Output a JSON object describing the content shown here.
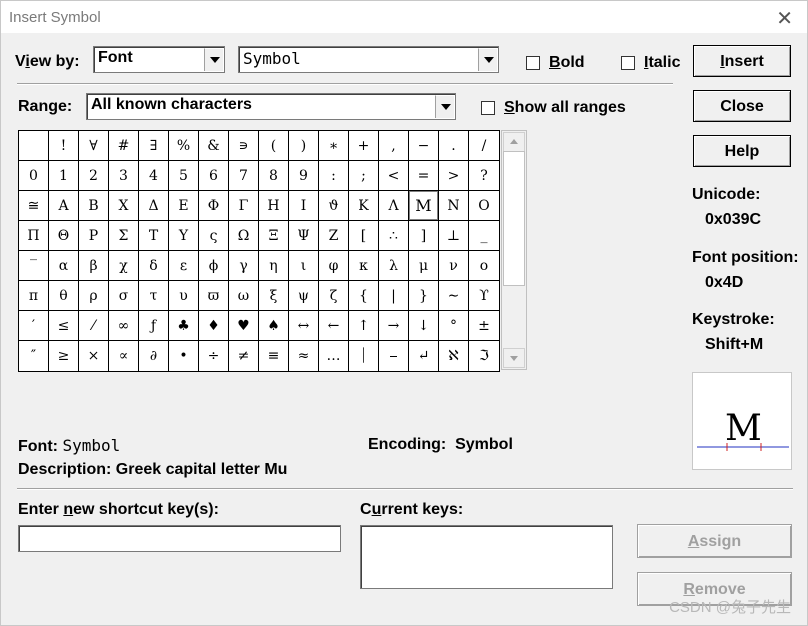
{
  "window": {
    "title": "Insert Symbol"
  },
  "view_by": {
    "label_pre": "V",
    "label_ul": "i",
    "label_post": "ew by:",
    "value": "Font",
    "font_value": "Symbol"
  },
  "options": {
    "bold": {
      "pre": "",
      "ul": "B",
      "post": "old",
      "checked": false
    },
    "italic": {
      "pre": "",
      "ul": "I",
      "post": "talic",
      "checked": false
    }
  },
  "range": {
    "label_pre": "Ran",
    "label_ul": "g",
    "label_post": "e:",
    "value": "All known characters"
  },
  "show_all": {
    "pre": "",
    "ul": "S",
    "post": "how all ranges",
    "checked": false
  },
  "buttons": {
    "insert": {
      "pre": "",
      "ul": "I",
      "post": "nsert"
    },
    "close": "Close",
    "help": "Help",
    "assign": {
      "pre": "",
      "ul": "A",
      "post": "ssign"
    },
    "remove": {
      "pre": "",
      "ul": "R",
      "post": "emove"
    }
  },
  "symbols": [
    [
      " ",
      "!",
      "∀",
      "#",
      "∃",
      "%",
      "&",
      "∍",
      "(",
      ")",
      "∗",
      "+",
      ",",
      "−",
      ".",
      "/"
    ],
    [
      "0",
      "1",
      "2",
      "3",
      "4",
      "5",
      "6",
      "7",
      "8",
      "9",
      ":",
      ";",
      "<",
      "=",
      ">",
      "?"
    ],
    [
      "≅",
      "Α",
      "Β",
      "Χ",
      "Δ",
      "Ε",
      "Φ",
      "Γ",
      "Η",
      "Ι",
      "ϑ",
      "Κ",
      "Λ",
      "Μ",
      "Ν",
      "Ο"
    ],
    [
      "Π",
      "Θ",
      "Ρ",
      "Σ",
      "Τ",
      "Υ",
      "ς",
      "Ω",
      "Ξ",
      "Ψ",
      "Ζ",
      "[",
      "∴",
      "]",
      "⊥",
      "_"
    ],
    [
      "‾",
      "α",
      "β",
      "χ",
      "δ",
      "ε",
      "ϕ",
      "γ",
      "η",
      "ι",
      "φ",
      "κ",
      "λ",
      "μ",
      "ν",
      "ο"
    ],
    [
      "π",
      "θ",
      "ρ",
      "σ",
      "τ",
      "υ",
      "ϖ",
      "ω",
      "ξ",
      "ψ",
      "ζ",
      "{",
      "|",
      "}",
      "∼",
      "ϒ"
    ],
    [
      "′",
      "≤",
      "⁄",
      "∞",
      "ƒ",
      "♣",
      "♦",
      "♥",
      "♠",
      "↔",
      "←",
      "↑",
      "→",
      "↓",
      "°",
      "±"
    ],
    [
      "″",
      "≥",
      "×",
      "∝",
      "∂",
      "•",
      "÷",
      "≠",
      "≡",
      "≈",
      "…",
      "⏐",
      "⎯",
      "↵",
      "ℵ",
      "ℑ"
    ]
  ],
  "selected": {
    "row": 2,
    "col": 13
  },
  "unicode": {
    "label": "Unicode:",
    "value": "0x039C"
  },
  "font_position": {
    "label": "Font position:",
    "value": "0x4D"
  },
  "keystroke": {
    "label": "Keystroke:",
    "value": "Shift+M"
  },
  "preview_char": "M",
  "font_info": {
    "label": "Font:",
    "value": "Symbol"
  },
  "encoding": {
    "label": "Encoding:",
    "value": "Symbol"
  },
  "description": {
    "label": "Description:",
    "value": "Greek capital letter Mu"
  },
  "shortcut": {
    "pre": "Enter ",
    "ul": "n",
    "post": "ew shortcut key(s):",
    "value": ""
  },
  "current_keys": {
    "pre": "C",
    "ul": "u",
    "post": "rrent keys:"
  },
  "watermark": "CSDN @兔子先生"
}
